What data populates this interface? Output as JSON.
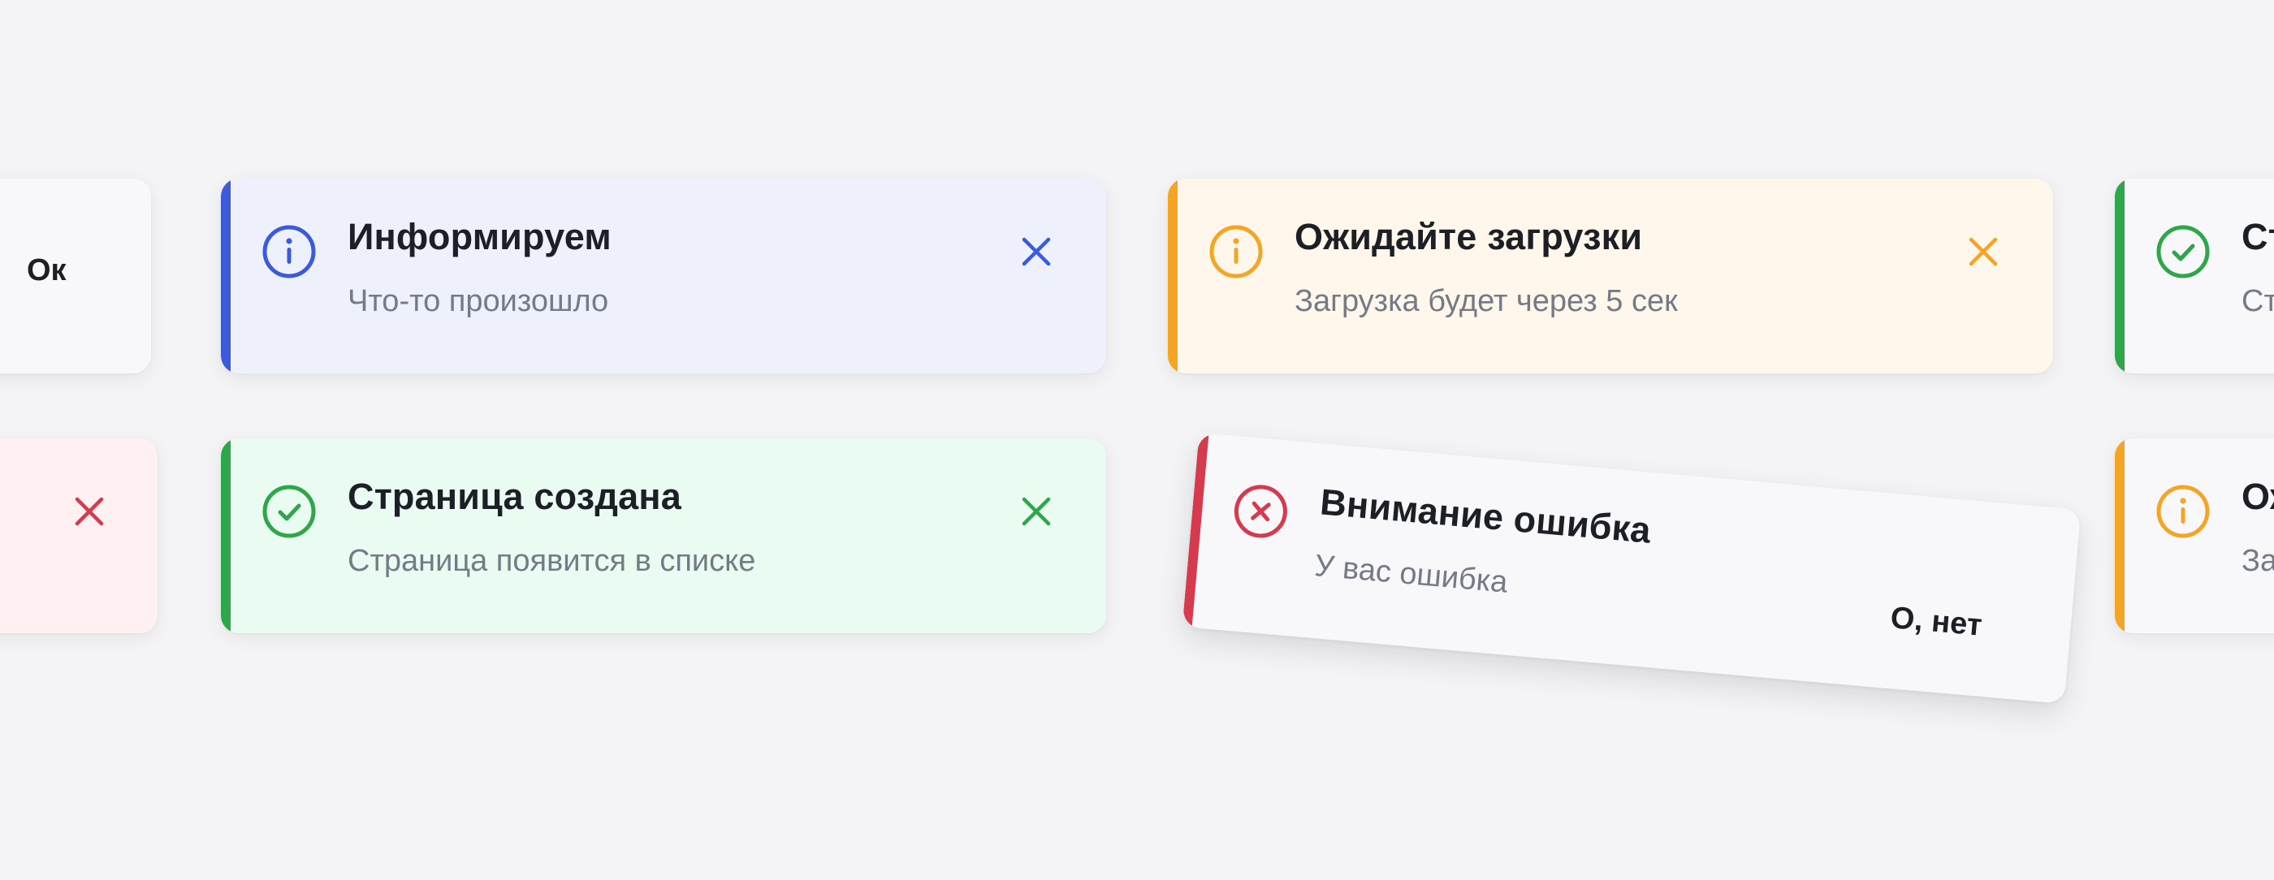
{
  "colors": {
    "info": "#3b5bdb",
    "warning": "#f5a524",
    "success": "#2ea64a",
    "error": "#d63a4d"
  },
  "toasts": {
    "ok_partial": {
      "action_label": "Ок"
    },
    "error_partial": {
      "close_icon": "close-icon"
    },
    "info": {
      "title": "Информируем",
      "description": "Что-то произошло",
      "icon": "info-icon"
    },
    "warning": {
      "title": "Ожидайте загрузки",
      "description": "Загрузка будет через 5 сек",
      "icon": "info-icon"
    },
    "success_partial_right": {
      "title": "Ст",
      "description": "Ст",
      "icon": "check-circle-icon"
    },
    "success": {
      "title": "Страница создана",
      "description": "Страница появится в списке",
      "icon": "check-circle-icon"
    },
    "error": {
      "title": "Внимание ошибка",
      "description": "У вас ошибка",
      "action_label": "О, нет",
      "icon": "x-circle-icon"
    },
    "warning_partial_right": {
      "title": "Ож",
      "description": "За",
      "icon": "info-icon"
    }
  }
}
